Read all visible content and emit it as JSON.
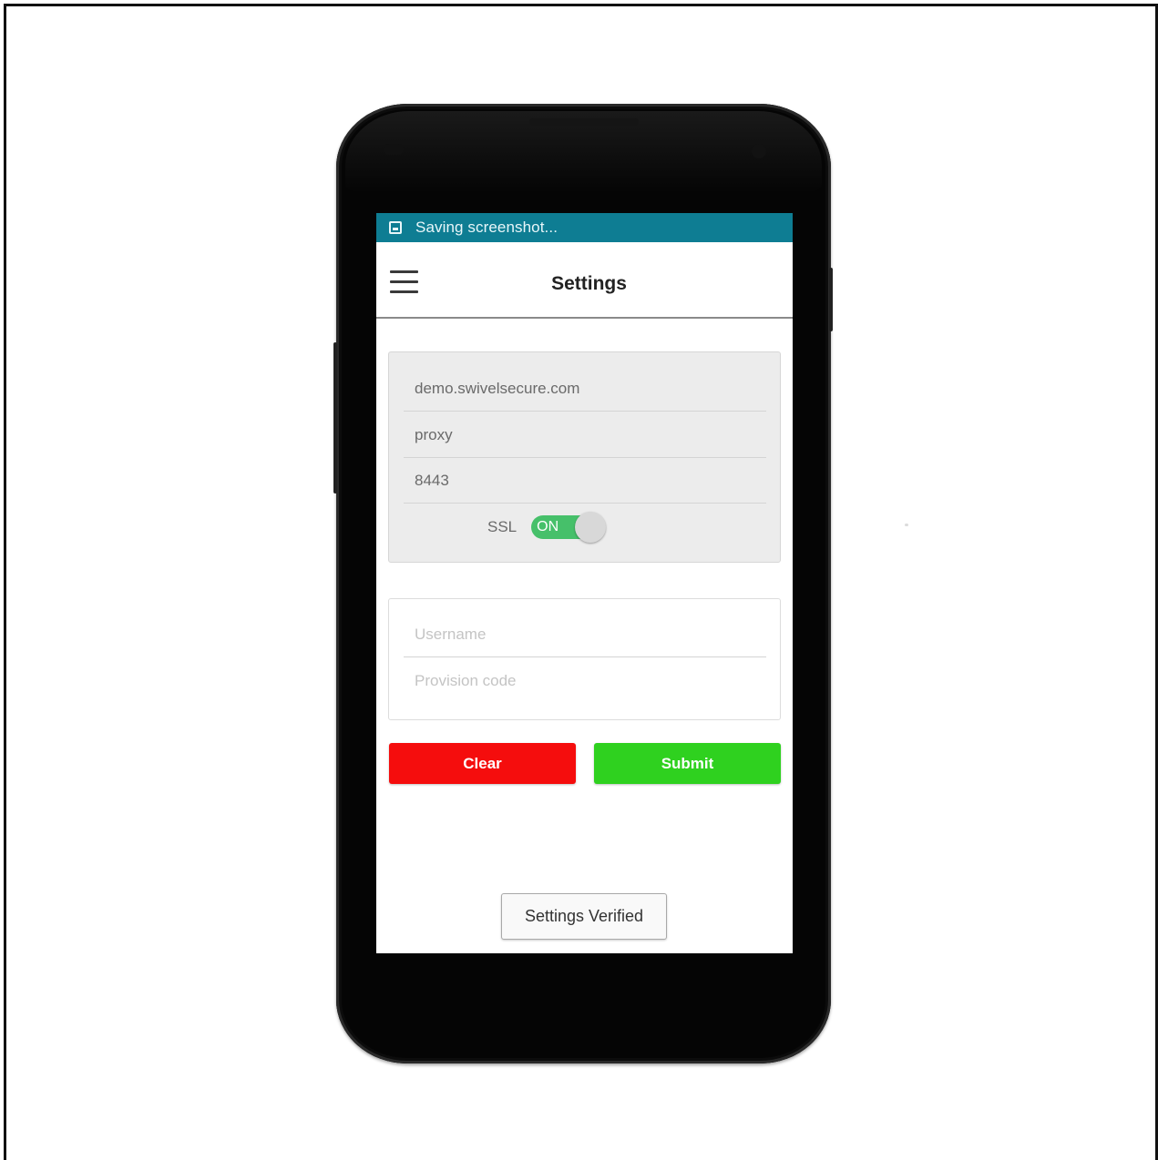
{
  "statusbar": {
    "notification": "Saving screenshot..."
  },
  "appbar": {
    "title": "Settings"
  },
  "server": {
    "host": "demo.swivelsecure.com",
    "path": "proxy",
    "port": "8443",
    "ssl_label": "SSL",
    "ssl_toggle_text": "ON",
    "ssl_enabled": true
  },
  "credentials": {
    "username_value": "",
    "username_placeholder": "Username",
    "provision_value": "",
    "provision_placeholder": "Provision code"
  },
  "actions": {
    "clear_label": "Clear",
    "submit_label": "Submit"
  },
  "toast": {
    "message": "Settings Verified"
  },
  "colors": {
    "statusbar": "#0e7d93",
    "clear": "#f50d0d",
    "submit": "#2fd11f",
    "toggle_on": "#46c06a"
  }
}
